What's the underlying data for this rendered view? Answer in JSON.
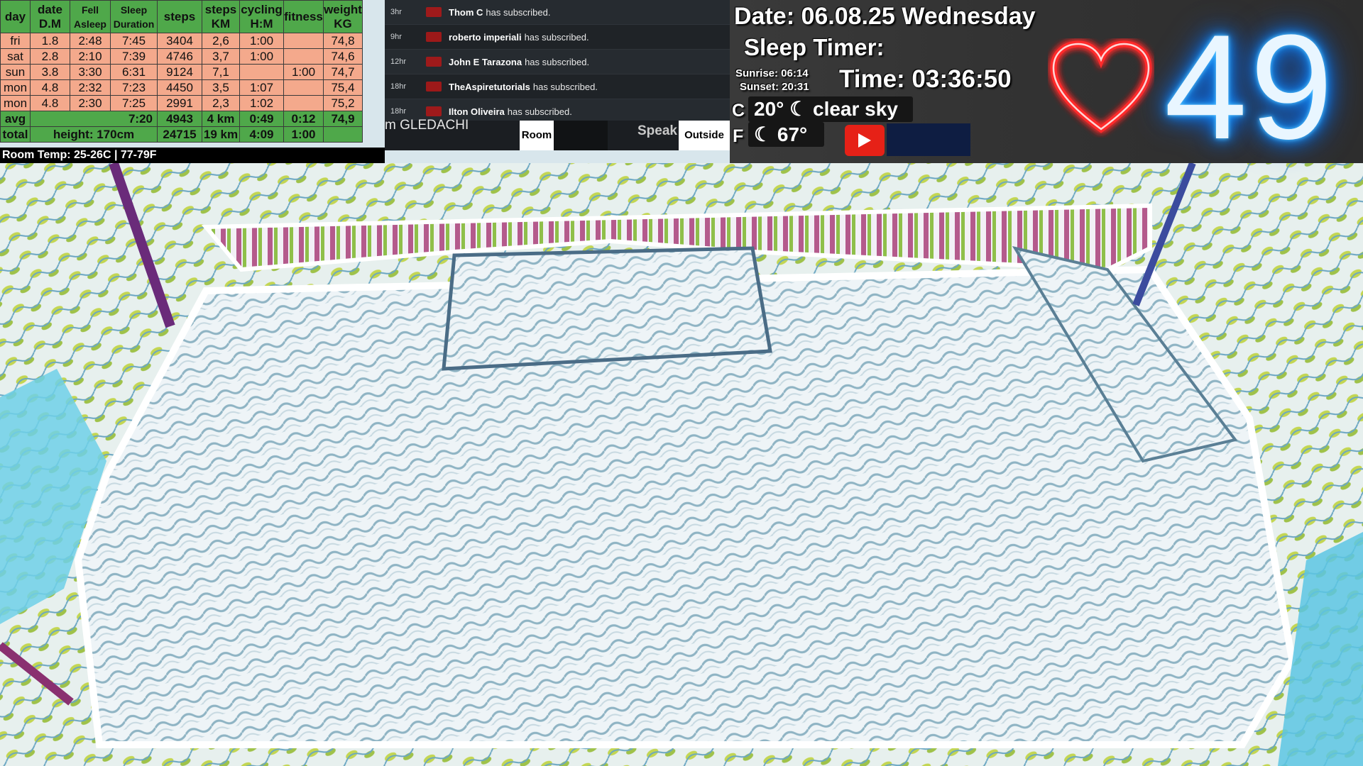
{
  "stats": {
    "headers": [
      {
        "top": "day",
        "bottom": ""
      },
      {
        "top": "date",
        "bottom": "D.M"
      },
      {
        "top": "Fell",
        "bottom": "Asleep"
      },
      {
        "top": "Sleep",
        "bottom": "Duration"
      },
      {
        "top": "steps",
        "bottom": ""
      },
      {
        "top": "steps",
        "bottom": "KM"
      },
      {
        "top": "cycling",
        "bottom": "H:M"
      },
      {
        "top": "fitness",
        "bottom": ""
      },
      {
        "top": "weight",
        "bottom": "KG"
      }
    ],
    "rows": [
      [
        "fri",
        "1.8",
        "2:48",
        "7:45",
        "3404",
        "2,6",
        "1:00",
        "",
        "74,8"
      ],
      [
        "sat",
        "2.8",
        "2:10",
        "7:39",
        "4746",
        "3,7",
        "1:00",
        "",
        "74,6"
      ],
      [
        "sun",
        "3.8",
        "3:30",
        "6:31",
        "9124",
        "7,1",
        "",
        "1:00",
        "74,7"
      ],
      [
        "mon",
        "4.8",
        "2:32",
        "7:23",
        "4450",
        "3,5",
        "1:07",
        "",
        "75,4"
      ],
      [
        "mon",
        "4.8",
        "2:30",
        "7:25",
        "2991",
        "2,3",
        "1:02",
        "",
        "75,2"
      ]
    ],
    "avg": {
      "label": "avg",
      "sleep": "7:20",
      "steps": "4943",
      "km": "4 km",
      "cycling": "0:49",
      "fitness": "0:12",
      "weight": "74,9"
    },
    "total": {
      "label": "total",
      "height": "height: 170cm",
      "steps": "24715",
      "km": "19 km",
      "cycling": "4:09",
      "fitness": "1:00"
    }
  },
  "room_temp": "Room Temp: 25-26C | 77-79F",
  "feed": [
    {
      "age": "3hr",
      "name": "Thom C",
      "action": "has subscribed."
    },
    {
      "age": "9hr",
      "name": "roberto imperiali",
      "action": "has subscribed."
    },
    {
      "age": "12hr",
      "name": "John E Tarazona",
      "action": "has subscribed."
    },
    {
      "age": "18hr",
      "name": "TheAspiretutorials",
      "action": "has subscribed."
    },
    {
      "age": "18hr",
      "name": "Ilton Oliveira",
      "action": "has subscribed."
    }
  ],
  "ticker": "m GLEDACHI",
  "room_button": "Room",
  "speak_label": "Speak",
  "outside_button": "Outside",
  "info": {
    "date": "Date: 06.08.25 Wednesday",
    "sleep_timer": "Sleep Timer:",
    "sunrise": "Sunrise: 06:14",
    "sunset": "Sunset: 20:31",
    "time": "Time: 03:36:50",
    "c_label": "C",
    "c_weather": "20° ☾ clear sky",
    "f_label": "F",
    "f_weather": "☾ 67°",
    "heart_rate": "49"
  },
  "colors": {
    "table_bg": "#f4a98c",
    "table_header": "#4fa84a",
    "heart": "#ff2a2a",
    "bpm_glow": "#1b9bff",
    "youtube": "#e62117"
  }
}
